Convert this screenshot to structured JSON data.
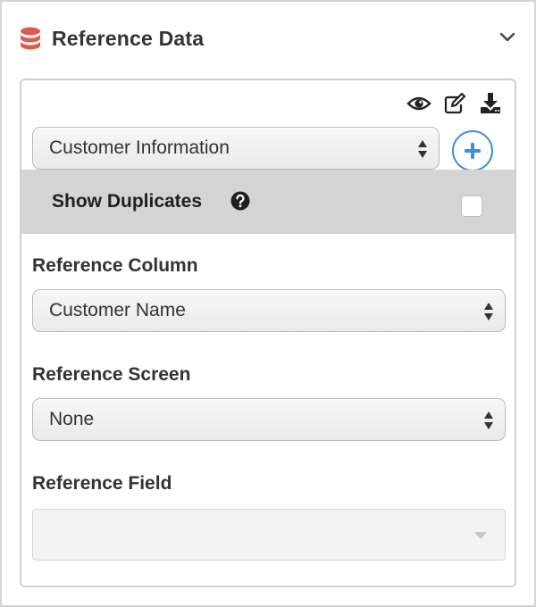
{
  "section": {
    "title": "Reference Data",
    "icon": "database-icon",
    "collapse_icon": "chevron-down-icon",
    "icon_color": "#e05a4f"
  },
  "toolbar": {
    "view_icon": "eye-icon",
    "edit_icon": "edit-icon",
    "download_icon": "download-icon"
  },
  "data_source": {
    "selected": "Customer Information",
    "add_icon": "plus-circle-icon",
    "accent_color": "#3b8fdc"
  },
  "show_duplicates": {
    "label": "Show Duplicates",
    "help_icon": "question-circle-icon",
    "checked": false
  },
  "reference_column": {
    "label": "Reference Column",
    "selected": "Customer Name"
  },
  "reference_screen": {
    "label": "Reference Screen",
    "selected": "None"
  },
  "reference_field": {
    "label": "Reference Field",
    "selected": "",
    "disabled": true
  }
}
